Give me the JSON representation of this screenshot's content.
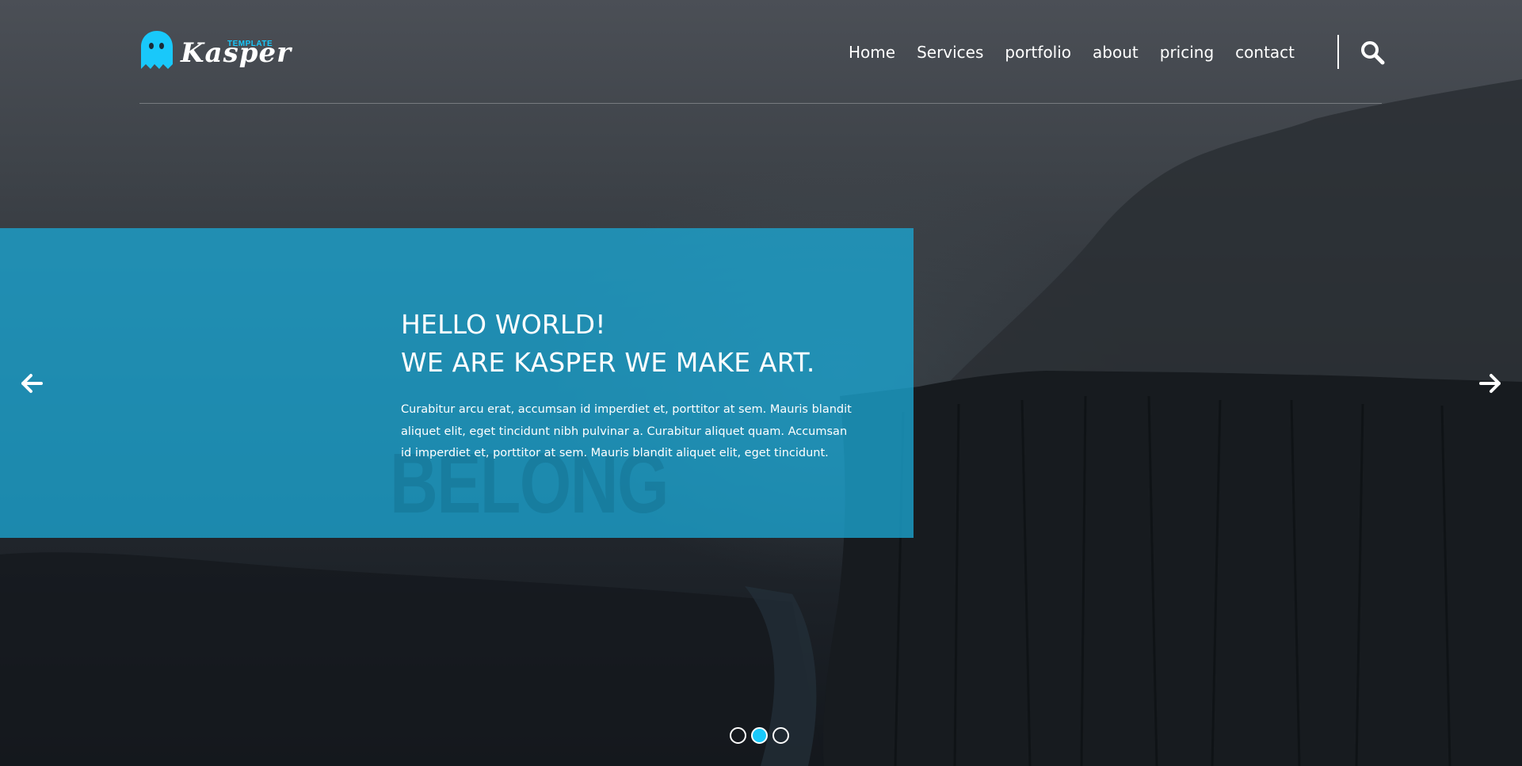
{
  "brand": {
    "name": "Kasper",
    "tag": "TEMPLATE"
  },
  "nav": {
    "items": [
      {
        "label": "Home"
      },
      {
        "label": "Services"
      },
      {
        "label": "portfolio"
      },
      {
        "label": "about"
      },
      {
        "label": "pricing"
      },
      {
        "label": "contact"
      }
    ],
    "search_icon": "search-icon"
  },
  "hero": {
    "title_line1": "HELLO WORLD!",
    "title_line2": "WE ARE KASPER WE MAKE ART.",
    "text": "Curabitur arcu erat, accumsan id imperdiet et, porttitor at sem. Mauris blandit aliquet elit, eget tincidunt nibh pulvinar a. Curabitur aliquet quam. Accumsan id imperdiet et, porttitor at sem. Mauris blandit aliquet elit, eget tincidunt.",
    "background_word": "BELONG"
  },
  "slider": {
    "prev_icon": "arrow-left-icon",
    "next_icon": "arrow-right-icon",
    "slide_count": 3,
    "active_index": 1
  },
  "colors": {
    "accent": "#19c8fa",
    "panel": "#1ba5d2",
    "text": "#ffffff"
  }
}
